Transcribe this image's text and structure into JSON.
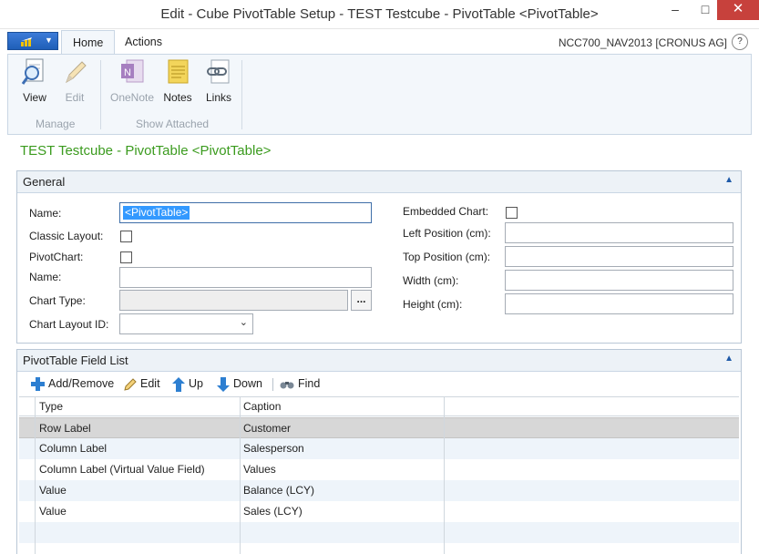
{
  "window": {
    "title": "Edit - Cube PivotTable Setup - TEST Testcube - PivotTable <PivotTable>",
    "controls": {
      "minimize": "–",
      "maximize": "□",
      "close": "✕"
    }
  },
  "tabs": {
    "home": "Home",
    "actions": "Actions"
  },
  "company": "NCC700_NAV2013 [CRONUS AG]",
  "help_label": "?",
  "ribbon": {
    "groups": [
      {
        "label": "Manage",
        "buttons": [
          {
            "label": "View",
            "enabled": true
          },
          {
            "label": "Edit",
            "enabled": false
          }
        ]
      },
      {
        "label": "Show Attached",
        "buttons": [
          {
            "label": "OneNote",
            "enabled": false
          },
          {
            "label": "Notes",
            "enabled": true
          },
          {
            "label": "Links",
            "enabled": true
          }
        ]
      }
    ]
  },
  "page_title": "TEST Testcube - PivotTable <PivotTable>",
  "general": {
    "header": "General",
    "collapse_glyph": "▲",
    "left_fields": {
      "name_label": "Name:",
      "name_value": "<PivotTable>",
      "classic_layout_label": "Classic Layout:",
      "classic_layout_checked": false,
      "pivotchart_label": "PivotChart:",
      "pivotchart_checked": false,
      "name2_label": "Name:",
      "name2_value": "",
      "chart_type_label": "Chart Type:",
      "chart_type_value": "",
      "assist_button": "...",
      "chart_layout_label": "Chart Layout ID:",
      "chart_layout_value": ""
    },
    "right_fields": {
      "embedded_chart_label": "Embedded Chart:",
      "embedded_chart_checked": false,
      "left_position_label": "Left Position (cm):",
      "left_position_value": "",
      "top_position_label": "Top Position (cm):",
      "top_position_value": "",
      "width_label": "Width (cm):",
      "width_value": "",
      "height_label": "Height (cm):",
      "height_value": ""
    }
  },
  "field_list": {
    "header": "PivotTable Field List",
    "collapse_glyph": "▲",
    "toolbar": {
      "add_remove": "Add/Remove",
      "edit": "Edit",
      "up": "Up",
      "down": "Down",
      "find": "Find"
    },
    "columns": {
      "type": "Type",
      "caption": "Caption"
    },
    "rows": [
      {
        "type": "Row Label",
        "caption": "Customer",
        "selected": true
      },
      {
        "type": "Column Label",
        "caption": "Salesperson",
        "selected": false
      },
      {
        "type": "Column Label (Virtual Value Field)",
        "caption": "Values",
        "selected": false
      },
      {
        "type": "Value",
        "caption": "Balance (LCY)",
        "selected": false
      },
      {
        "type": "Value",
        "caption": "Sales (LCY)",
        "selected": false
      }
    ]
  },
  "colors": {
    "title_green": "#3b9b1e",
    "selection_blue": "#3399ff",
    "ribbon_bg": "#f3f7fb",
    "close_red": "#c7413c"
  },
  "icons": {
    "view": "magnifier-document-icon",
    "edit": "pencil-icon",
    "onenote": "onenote-icon",
    "notes": "sticky-note-icon",
    "links": "link-chain-icon",
    "add_remove": "plus-icon",
    "up": "arrow-up-icon",
    "down": "arrow-down-icon",
    "find": "binoculars-icon"
  }
}
